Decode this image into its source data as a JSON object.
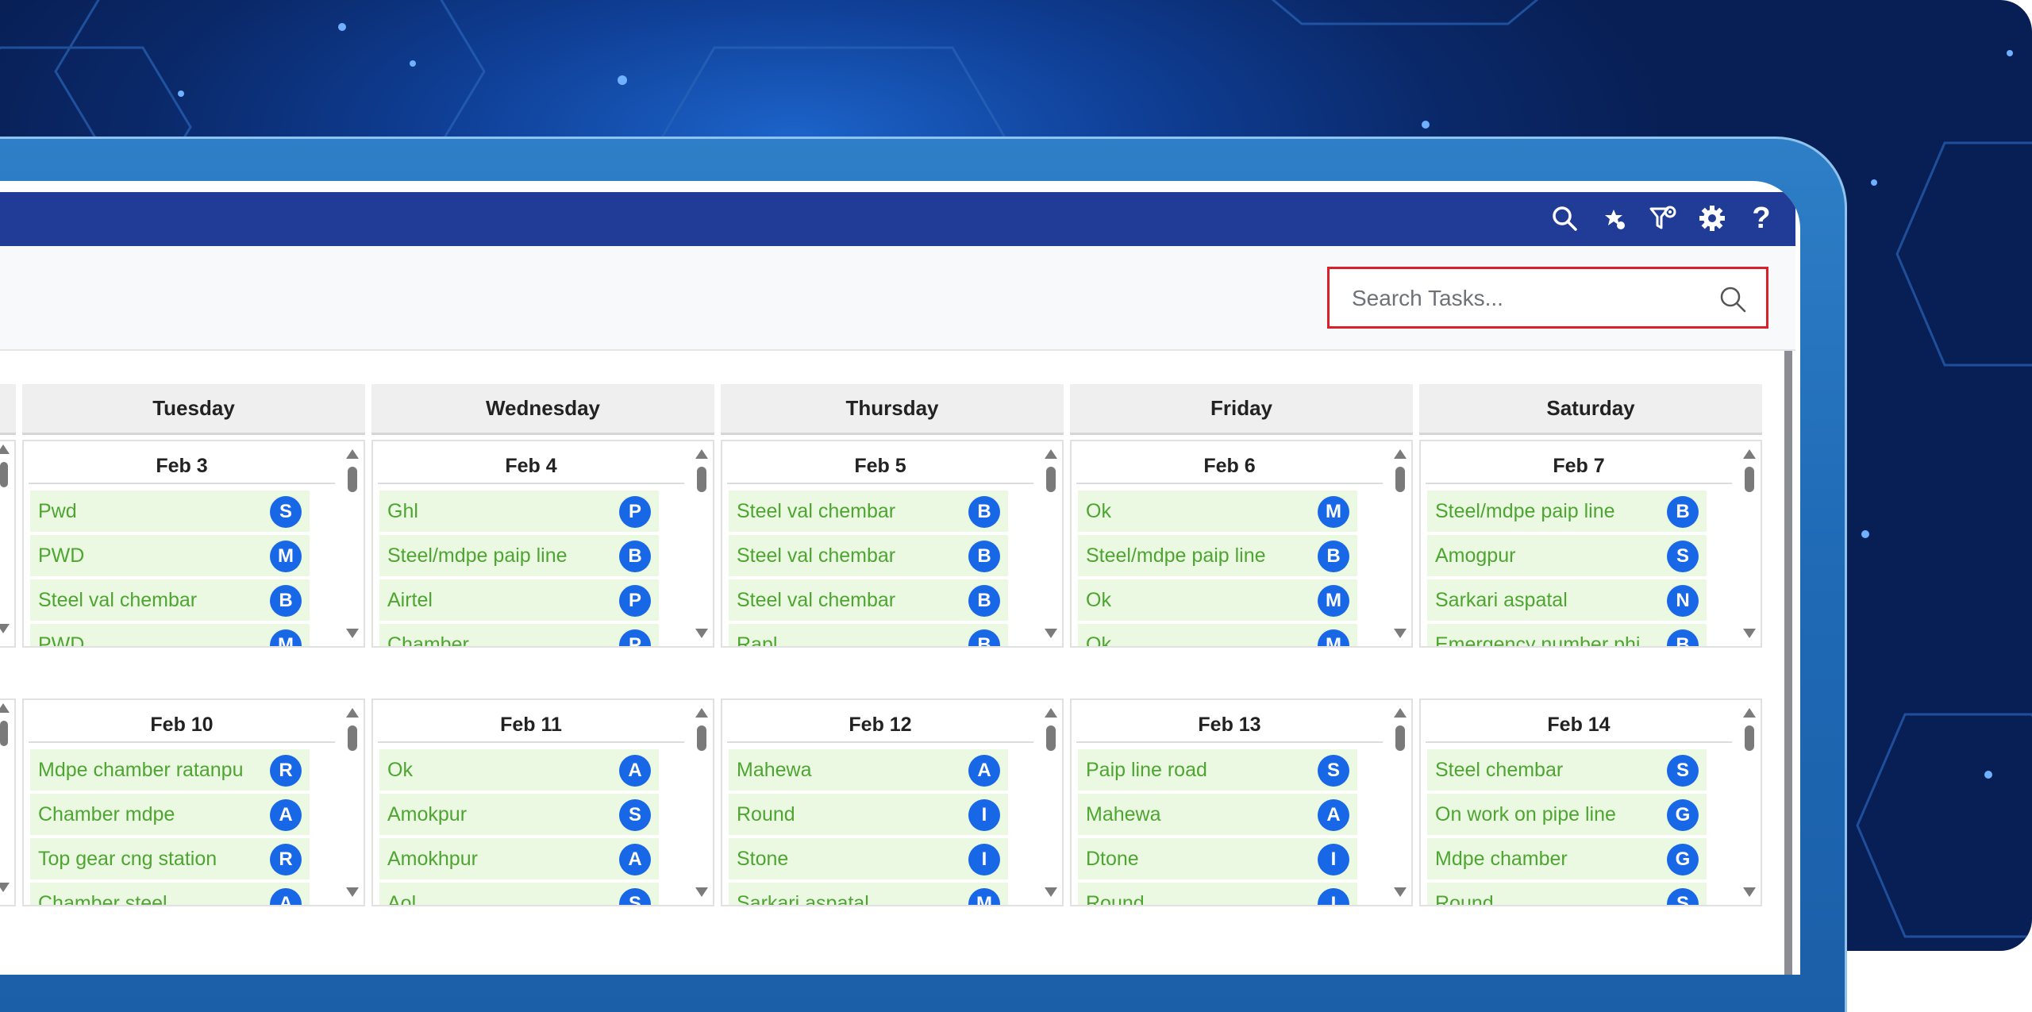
{
  "search": {
    "placeholder": "Search Tasks..."
  },
  "toolbar_icons": [
    "search-icon",
    "star-badge-icon",
    "funnel-settings-icon",
    "gear-icon",
    "help-icon"
  ],
  "help_glyph": "?",
  "colors": {
    "topbar": "#213c96",
    "task_bg": "#ebf9e3",
    "task_text": "#4ea531",
    "avatar": "#1767e6",
    "search_border": "#d8212b"
  },
  "days": [
    "Tuesday",
    "Wednesday",
    "Thursday",
    "Friday",
    "Saturday"
  ],
  "weeks": [
    {
      "cells": [
        {
          "date": "Feb 3",
          "tasks": [
            {
              "name": "Pwd",
              "initial": "S"
            },
            {
              "name": "PWD",
              "initial": "M"
            },
            {
              "name": "Steel val chembar",
              "initial": "B"
            },
            {
              "name": "PWD",
              "initial": "M"
            }
          ]
        },
        {
          "date": "Feb 4",
          "tasks": [
            {
              "name": "Ghl",
              "initial": "P"
            },
            {
              "name": "Steel/mdpe paip line",
              "initial": "B"
            },
            {
              "name": "Airtel",
              "initial": "P"
            },
            {
              "name": "Chamber",
              "initial": "P"
            }
          ]
        },
        {
          "date": "Feb 5",
          "tasks": [
            {
              "name": "Steel val chembar",
              "initial": "B"
            },
            {
              "name": "Steel val chembar",
              "initial": "B"
            },
            {
              "name": "Steel val chembar",
              "initial": "B"
            },
            {
              "name": "Rapl",
              "initial": "B"
            }
          ]
        },
        {
          "date": "Feb 6",
          "tasks": [
            {
              "name": "Ok",
              "initial": "M"
            },
            {
              "name": "Steel/mdpe paip line",
              "initial": "B"
            },
            {
              "name": "Ok",
              "initial": "M"
            },
            {
              "name": "Ok",
              "initial": "M"
            }
          ]
        },
        {
          "date": "Feb 7",
          "tasks": [
            {
              "name": "Steel/mdpe paip line",
              "initial": "B"
            },
            {
              "name": "Amogpur",
              "initial": "S"
            },
            {
              "name": "Sarkari aspatal",
              "initial": "N"
            },
            {
              "name": "Emergency number phi",
              "initial": "B"
            }
          ]
        }
      ]
    },
    {
      "cells": [
        {
          "date": "Feb 10",
          "tasks": [
            {
              "name": "Mdpe chamber ratanpu",
              "initial": "R"
            },
            {
              "name": "Chamber mdpe",
              "initial": "A"
            },
            {
              "name": "Top gear cng station",
              "initial": "R"
            },
            {
              "name": "Chamber steel",
              "initial": "A"
            }
          ]
        },
        {
          "date": "Feb 11",
          "tasks": [
            {
              "name": "Ok",
              "initial": "A"
            },
            {
              "name": "Amokpur",
              "initial": "S"
            },
            {
              "name": "Amokhpur",
              "initial": "A"
            },
            {
              "name": "Aol",
              "initial": "S"
            }
          ]
        },
        {
          "date": "Feb 12",
          "tasks": [
            {
              "name": "Mahewa",
              "initial": "A"
            },
            {
              "name": "Round",
              "initial": "I"
            },
            {
              "name": "Stone",
              "initial": "I"
            },
            {
              "name": "Sarkari aspatal",
              "initial": "M"
            }
          ]
        },
        {
          "date": "Feb 13",
          "tasks": [
            {
              "name": "Paip line road",
              "initial": "S"
            },
            {
              "name": "Mahewa",
              "initial": "A"
            },
            {
              "name": "Dtone",
              "initial": "I"
            },
            {
              "name": "Round",
              "initial": "I"
            }
          ]
        },
        {
          "date": "Feb 14",
          "tasks": [
            {
              "name": "Steel chembar",
              "initial": "S"
            },
            {
              "name": "On work on pipe line",
              "initial": "G"
            },
            {
              "name": "Mdpe chamber",
              "initial": "G"
            },
            {
              "name": "Round",
              "initial": "S"
            }
          ]
        }
      ]
    }
  ]
}
